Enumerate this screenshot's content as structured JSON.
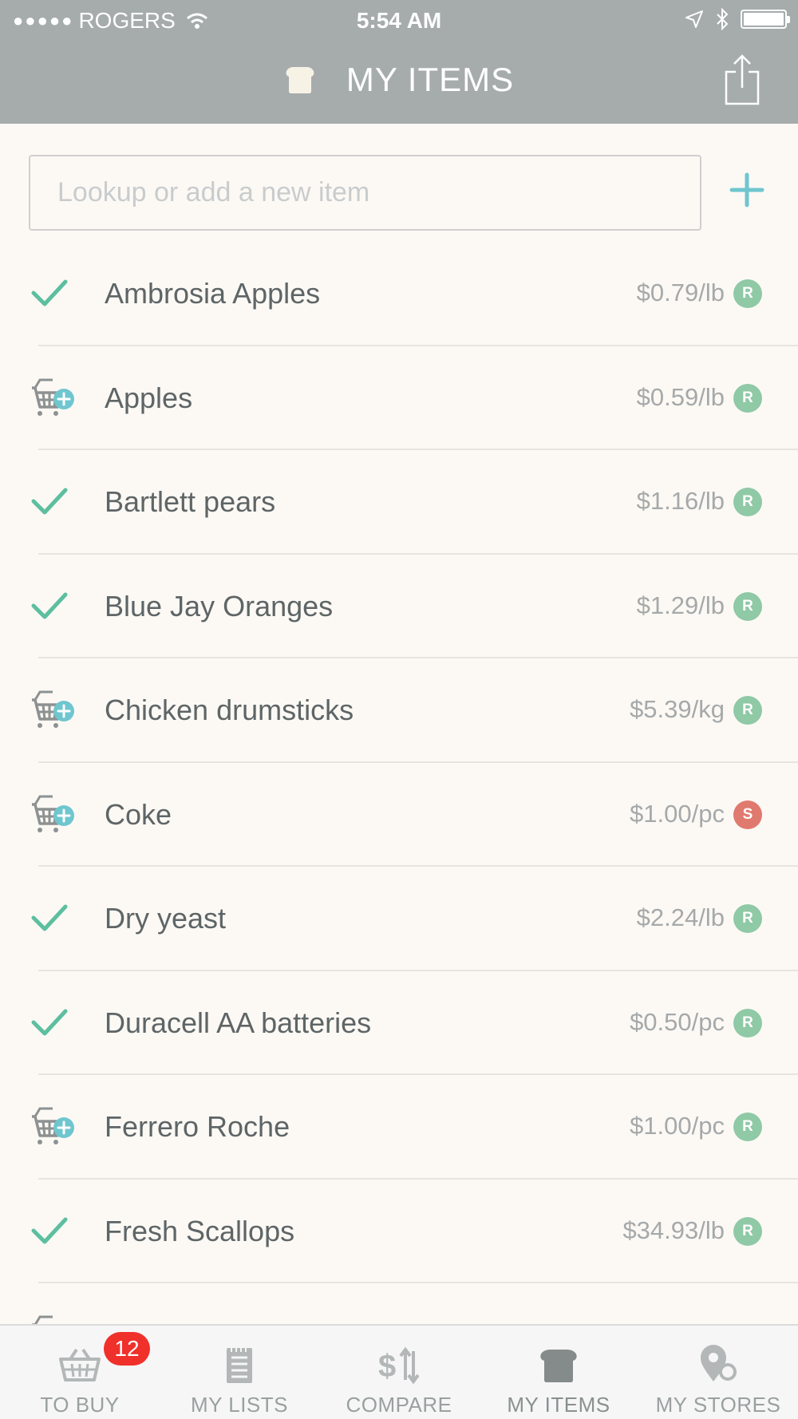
{
  "status_bar": {
    "carrier": "ROGERS",
    "time": "5:54 AM"
  },
  "header": {
    "title": "MY ITEMS",
    "title_icon": "bread-icon",
    "share_icon": "share-icon"
  },
  "search": {
    "placeholder": "Lookup or add a new item",
    "value": "",
    "add_icon": "plus-icon"
  },
  "items": [
    {
      "name": "Ambrosia Apples",
      "price": "$0.79/lb",
      "badge": "R",
      "status": "checked"
    },
    {
      "name": "Apples",
      "price": "$0.59/lb",
      "badge": "R",
      "status": "add-to-basket"
    },
    {
      "name": "Bartlett pears",
      "price": "$1.16/lb",
      "badge": "R",
      "status": "checked"
    },
    {
      "name": "Blue Jay Oranges",
      "price": "$1.29/lb",
      "badge": "R",
      "status": "checked"
    },
    {
      "name": "Chicken drumsticks",
      "price": "$5.39/kg",
      "badge": "R",
      "status": "add-to-basket"
    },
    {
      "name": "Coke",
      "price": "$1.00/pc",
      "badge": "S",
      "status": "add-to-basket"
    },
    {
      "name": "Dry yeast",
      "price": "$2.24/lb",
      "badge": "R",
      "status": "checked"
    },
    {
      "name": "Duracell AA batteries",
      "price": "$0.50/pc",
      "badge": "R",
      "status": "checked"
    },
    {
      "name": "Ferrero Roche",
      "price": "$1.00/pc",
      "badge": "R",
      "status": "add-to-basket"
    },
    {
      "name": "Fresh Scallops",
      "price": "$34.93/lb",
      "badge": "R",
      "status": "checked"
    },
    {
      "name": "",
      "price": "",
      "badge": "",
      "status": "add-to-basket"
    }
  ],
  "colors": {
    "header_bg": "#a6acac",
    "page_bg": "#fcf9f5",
    "check": "#5dbf9f",
    "add_plus": "#6fc6cf",
    "badge_regular": "#8fc9a5",
    "badge_sale": "#e07a6e",
    "tab_badge": "#f0302b"
  },
  "tabbar": {
    "tabs": [
      {
        "label": "TO BUY",
        "icon": "basket-icon",
        "badge": "12"
      },
      {
        "label": "MY LISTS",
        "icon": "list-icon"
      },
      {
        "label": "COMPARE",
        "icon": "compare-icon"
      },
      {
        "label": "MY ITEMS",
        "icon": "bread-icon",
        "active": true
      },
      {
        "label": "MY STORES",
        "icon": "store-pin-icon"
      }
    ]
  }
}
